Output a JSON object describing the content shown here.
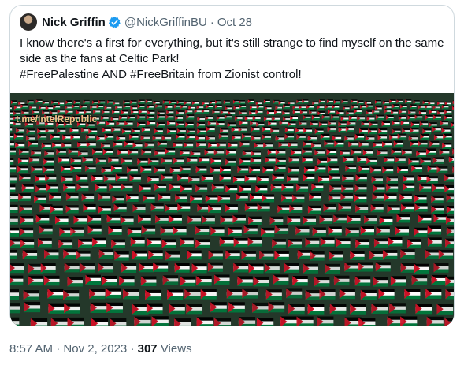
{
  "tweet": {
    "author_name": "Nick Griffin",
    "handle": "@NickGriffinBU",
    "separator": "·",
    "date": "Oct 28",
    "text": "I know there's a first for everything, but it's still strange to find myself on the same side as the fans at Celtic Park!\n#FreePalestine AND #FreeBritain from Zionist control!",
    "media": {
      "watermark": "t.me/IntelRepublic",
      "flag_colors": [
        "#000000",
        "#ffffff",
        "#007a3d",
        "#ce1126"
      ]
    }
  },
  "footer": {
    "time": "8:57 AM",
    "separator1": " · ",
    "date": "Nov 2, 2023",
    "separator2": " · ",
    "views_count": "307",
    "views_label": " Views"
  },
  "colors": {
    "verified": "#1d9bf0",
    "border": "#cfd9de",
    "muted": "#536471"
  }
}
